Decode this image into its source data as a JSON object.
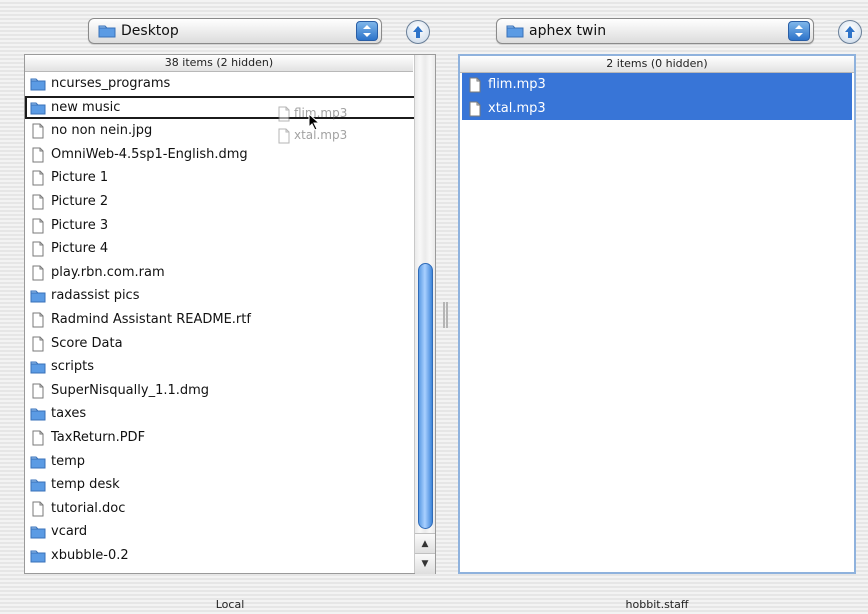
{
  "left_pane": {
    "location": "Desktop",
    "header": "38 items (2 hidden)",
    "footer": "Local",
    "items": [
      {
        "name": "ncurses_programs",
        "icon": "folder-icon",
        "state": "normal"
      },
      {
        "name": "new music",
        "icon": "folder-icon",
        "state": "drop-target"
      },
      {
        "name": "no non nein.jpg",
        "icon": "document-icon",
        "state": "normal"
      },
      {
        "name": "OmniWeb-4.5sp1-English.dmg",
        "icon": "document-icon",
        "state": "normal"
      },
      {
        "name": "Picture 1",
        "icon": "document-icon",
        "state": "normal"
      },
      {
        "name": "Picture 2",
        "icon": "document-icon",
        "state": "normal"
      },
      {
        "name": "Picture 3",
        "icon": "document-icon",
        "state": "normal"
      },
      {
        "name": "Picture 4",
        "icon": "document-icon",
        "state": "normal"
      },
      {
        "name": "play.rbn.com.ram",
        "icon": "document-icon",
        "state": "normal"
      },
      {
        "name": "radassist pics",
        "icon": "folder-icon",
        "state": "normal"
      },
      {
        "name": "Radmind Assistant README.rtf",
        "icon": "document-icon",
        "state": "normal"
      },
      {
        "name": "Score Data",
        "icon": "document-icon",
        "state": "normal"
      },
      {
        "name": "scripts",
        "icon": "folder-icon",
        "state": "normal"
      },
      {
        "name": "SuperNisqually_1.1.dmg",
        "icon": "document-icon",
        "state": "normal"
      },
      {
        "name": "taxes",
        "icon": "folder-icon",
        "state": "normal"
      },
      {
        "name": "TaxReturn.PDF",
        "icon": "document-icon",
        "state": "normal"
      },
      {
        "name": "temp",
        "icon": "folder-icon",
        "state": "normal"
      },
      {
        "name": "temp desk",
        "icon": "folder-icon",
        "state": "normal"
      },
      {
        "name": "tutorial.doc",
        "icon": "document-icon",
        "state": "normal"
      },
      {
        "name": "vcard",
        "icon": "folder-icon",
        "state": "normal"
      },
      {
        "name": "xbubble-0.2",
        "icon": "folder-icon",
        "state": "normal"
      }
    ],
    "scroll_position": 0.75
  },
  "right_pane": {
    "location": "aphex twin",
    "header": "2 items (0 hidden)",
    "footer": "hobbit.staff",
    "items": [
      {
        "name": "flim.mp3",
        "icon": "document-icon",
        "state": "selected"
      },
      {
        "name": "xtal.mp3",
        "icon": "document-icon",
        "state": "selected"
      }
    ]
  },
  "drag_ghost": {
    "items": [
      {
        "name": "flim.mp3",
        "icon": "document-icon"
      },
      {
        "name": "xtal.mp3",
        "icon": "document-icon"
      }
    ]
  },
  "colors": {
    "selection": "#3875d7",
    "folder": "#5b9be4",
    "accent_blue": "#2d73c9"
  }
}
